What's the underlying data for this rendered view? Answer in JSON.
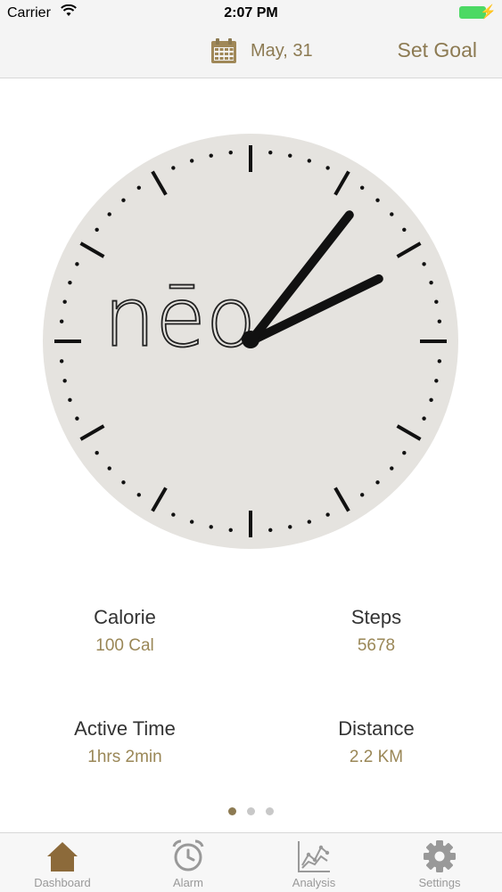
{
  "status_bar": {
    "carrier": "Carrier",
    "time": "2:07 PM"
  },
  "nav": {
    "date": "May, 31",
    "set_goal": "Set Goal"
  },
  "clock": {
    "brand": "nēo",
    "hour": 2,
    "minute": 7
  },
  "stats": {
    "calorie": {
      "label": "Calorie",
      "value": "100 Cal"
    },
    "steps": {
      "label": "Steps",
      "value": "5678"
    },
    "active_time": {
      "label": "Active Time",
      "value": "1hrs 2min"
    },
    "distance": {
      "label": "Distance",
      "value": "2.2 KM"
    }
  },
  "pager": {
    "count": 3,
    "active": 0
  },
  "tabs": [
    {
      "label": "Dashboard",
      "icon": "home-icon",
      "active": true
    },
    {
      "label": "Alarm",
      "icon": "alarm-clock-icon",
      "active": false
    },
    {
      "label": "Analysis",
      "icon": "analysis-chart-icon",
      "active": false
    },
    {
      "label": "Settings",
      "icon": "gear-icon",
      "active": false
    }
  ],
  "colors": {
    "accent": "#8c7a52",
    "dial": "#e5e3df",
    "battery": "#4cd964"
  }
}
